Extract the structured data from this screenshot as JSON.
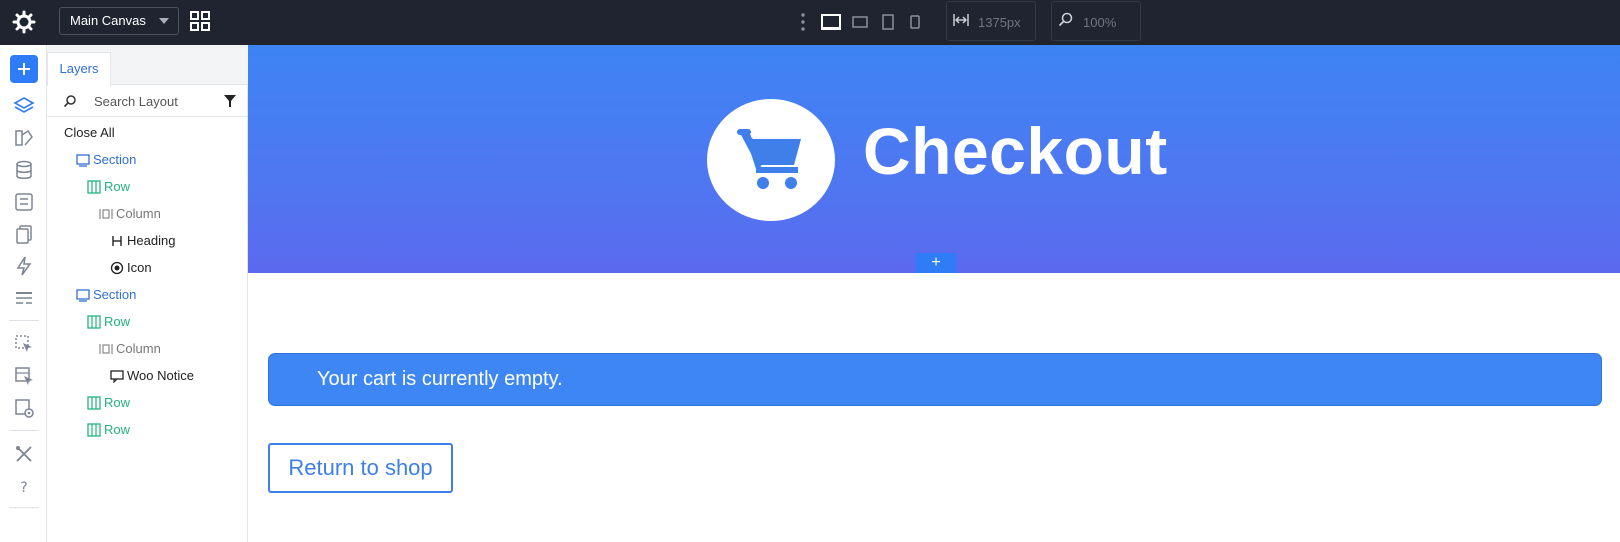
{
  "topbar": {
    "canvas_select": "Main Canvas",
    "width_value": "1375px",
    "zoom_value": "100%",
    "colors": {
      "bg": "#1f2430",
      "active_device": "#ffffff",
      "inactive": "#8b919c"
    }
  },
  "rail": {
    "icons": [
      "plus-icon",
      "layers-icon",
      "brush-icon",
      "database-icon",
      "form-icon",
      "pages-icon",
      "bolt-icon",
      "template-icon",
      "cursor-select-icon",
      "cursor-grid-icon",
      "preview-icon",
      "tools-icon",
      "help-icon"
    ]
  },
  "layers": {
    "tab": "Layers",
    "search_placeholder": "Search Layout",
    "close_all": "Close All",
    "items": [
      {
        "label": "Section",
        "type": "section"
      },
      {
        "label": "Row",
        "type": "row"
      },
      {
        "label": "Column",
        "type": "column"
      },
      {
        "label": "Heading",
        "type": "heading"
      },
      {
        "label": "Icon",
        "type": "icon"
      },
      {
        "label": "Section",
        "type": "section"
      },
      {
        "label": "Row",
        "type": "row"
      },
      {
        "label": "Column",
        "type": "column"
      },
      {
        "label": "Woo Notice",
        "type": "notice"
      },
      {
        "label": "Row",
        "type": "row"
      },
      {
        "label": "Row",
        "type": "row"
      }
    ]
  },
  "canvas": {
    "hero_title": "Checkout",
    "add_section_label": "+",
    "notice_text": "Your cart is currently empty.",
    "return_button": "Return to shop",
    "colors": {
      "hero_top": "#3d84f4",
      "hero_bottom": "#5b69ee",
      "notice": "#3f86f5",
      "accent": "#3f7fe9"
    }
  }
}
